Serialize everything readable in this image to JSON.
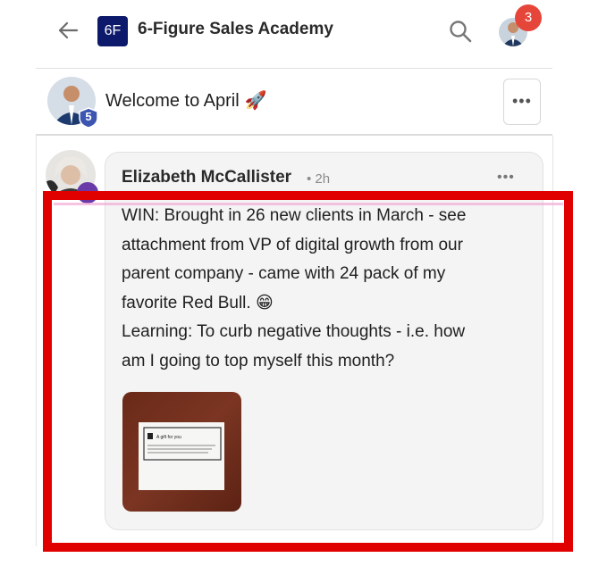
{
  "header": {
    "logo_text": "6F",
    "title": "6-Figure Sales Academy",
    "notification_count": "3"
  },
  "channel": {
    "title": "Welcome to April",
    "title_emoji": "🚀",
    "badge_count": "5",
    "menu_label": "•••"
  },
  "post": {
    "author": "Elizabeth McCallister",
    "time": "• 2h",
    "menu_label": "•••",
    "body_lines": [
      "WIN: Brought in 26 new clients in March - see",
      "attachment from VP of digital growth from our",
      "parent company - came with 24 pack of my",
      "favorite Red Bull. 😁",
      "Learning: To curb negative thoughts - i.e. how",
      "am I going to top myself this month?"
    ],
    "attachment": {
      "card_title": "A gift for you",
      "card_text": "Thank you for your efforts to satisfy the customer's needs. A small reward."
    }
  },
  "colors": {
    "logo_bg": "#0d1a6b",
    "notification": "#e6453a",
    "level_badge": "#3b55b0",
    "highlight": "#e00000"
  }
}
